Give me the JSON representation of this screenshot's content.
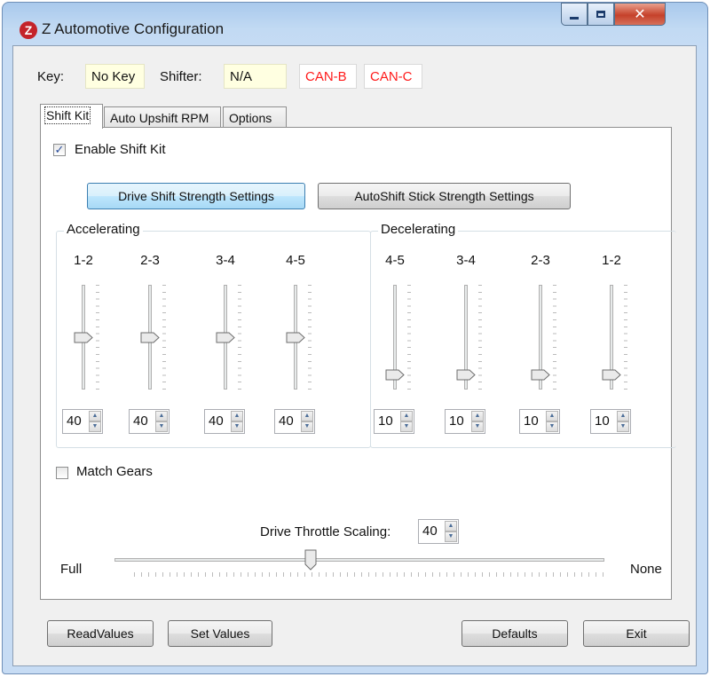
{
  "window": {
    "title": "Z Automotive Configuration",
    "icon_name": "z-app-icon"
  },
  "status": {
    "key_label": "Key:",
    "key_value": "No Key",
    "shifter_label": "Shifter:",
    "shifter_value": "N/A",
    "can_b": "CAN-B",
    "can_c": "CAN-C"
  },
  "tabs": [
    {
      "label": "Shift Kit",
      "selected": true
    },
    {
      "label": "Auto Upshift RPM",
      "selected": false
    },
    {
      "label": "Options",
      "selected": false
    }
  ],
  "shift_kit": {
    "enable_label": "Enable Shift Kit",
    "enable_checked": true,
    "drive_button": "Drive Shift Strength Settings",
    "autoshift_button": "AutoShift Stick Strength Settings",
    "accelerating": {
      "title": "Accelerating",
      "gears": [
        {
          "label": "1-2",
          "value": "40",
          "level": 0.5
        },
        {
          "label": "2-3",
          "value": "40",
          "level": 0.5
        },
        {
          "label": "3-4",
          "value": "40",
          "level": 0.5
        },
        {
          "label": "4-5",
          "value": "40",
          "level": 0.5
        }
      ]
    },
    "decelerating": {
      "title": "Decelerating",
      "gears": [
        {
          "label": "4-5",
          "value": "10",
          "level": 0.1
        },
        {
          "label": "3-4",
          "value": "10",
          "level": 0.1
        },
        {
          "label": "2-3",
          "value": "10",
          "level": 0.1
        },
        {
          "label": "1-2",
          "value": "10",
          "level": 0.1
        }
      ]
    },
    "match_gears_label": "Match Gears",
    "match_gears_checked": false,
    "throttle_label": "Drive Throttle Scaling:",
    "throttle_value": "40",
    "throttle_level": 0.4,
    "full_label": "Full",
    "none_label": "None"
  },
  "footer": {
    "read": "ReadValues",
    "set": "Set Values",
    "defaults": "Defaults",
    "exit": "Exit"
  }
}
